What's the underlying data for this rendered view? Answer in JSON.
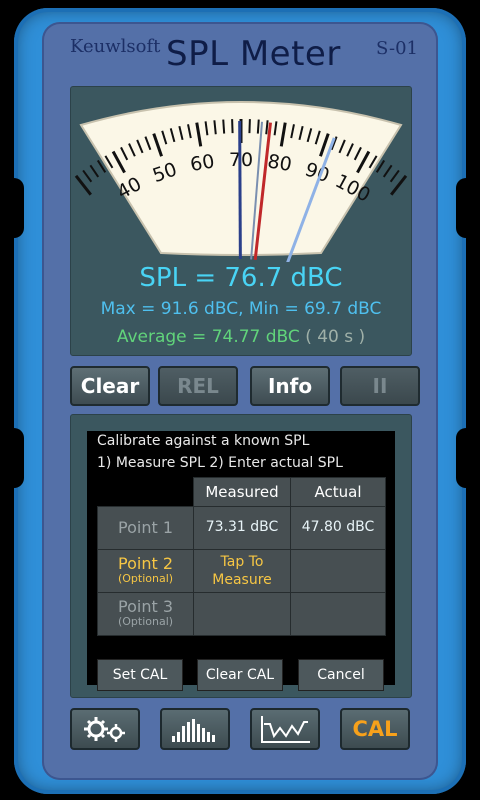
{
  "header": {
    "brand": "Keuwlsoft",
    "title": "SPL Meter",
    "model": "S-01"
  },
  "meter": {
    "scale_labels": [
      "40",
      "50",
      "60",
      "70",
      "80",
      "90",
      "100"
    ],
    "scale_min": 30,
    "scale_max": 110,
    "current_value": 76.7,
    "max_value": 91.6,
    "average_value": 74.77,
    "min_value": 69.7
  },
  "readout": {
    "spl": "SPL = 76.7 dBC",
    "maxmin": "Max = 91.6 dBC,  Min = 69.7 dBC",
    "average": "Average = 74.77 dBC",
    "duration": "( 40 s )"
  },
  "controls": {
    "clear": "Clear",
    "rel": "REL",
    "info": "Info",
    "pause": "II"
  },
  "calibration": {
    "line1": "Calibrate against a known SPL",
    "line2": "1) Measure SPL  2) Enter actual SPL",
    "col_measured": "Measured",
    "col_actual": "Actual",
    "rows": [
      {
        "label": "Point 1",
        "optional": "",
        "measured": "73.31 dBC",
        "actual": "47.80 dBC"
      },
      {
        "label": "Point 2",
        "optional": "(Optional)",
        "measured": "Tap To Measure",
        "actual": ""
      },
      {
        "label": "Point 3",
        "optional": "(Optional)",
        "measured": "",
        "actual": ""
      }
    ],
    "set_cal": "Set CAL",
    "clear_cal": "Clear CAL",
    "cancel": "Cancel"
  },
  "bottom_nav": {
    "settings_icon": "gears-icon",
    "spectrum_icon": "bar-spectrum-icon",
    "history_icon": "waveform-graph-icon",
    "cal": "CAL"
  },
  "colors": {
    "spl": "#49d4f5",
    "maxmin": "#4fc0ef",
    "average": "#61d47b",
    "cal_accent": "#f7a11b",
    "device": "#2f8fd8"
  }
}
